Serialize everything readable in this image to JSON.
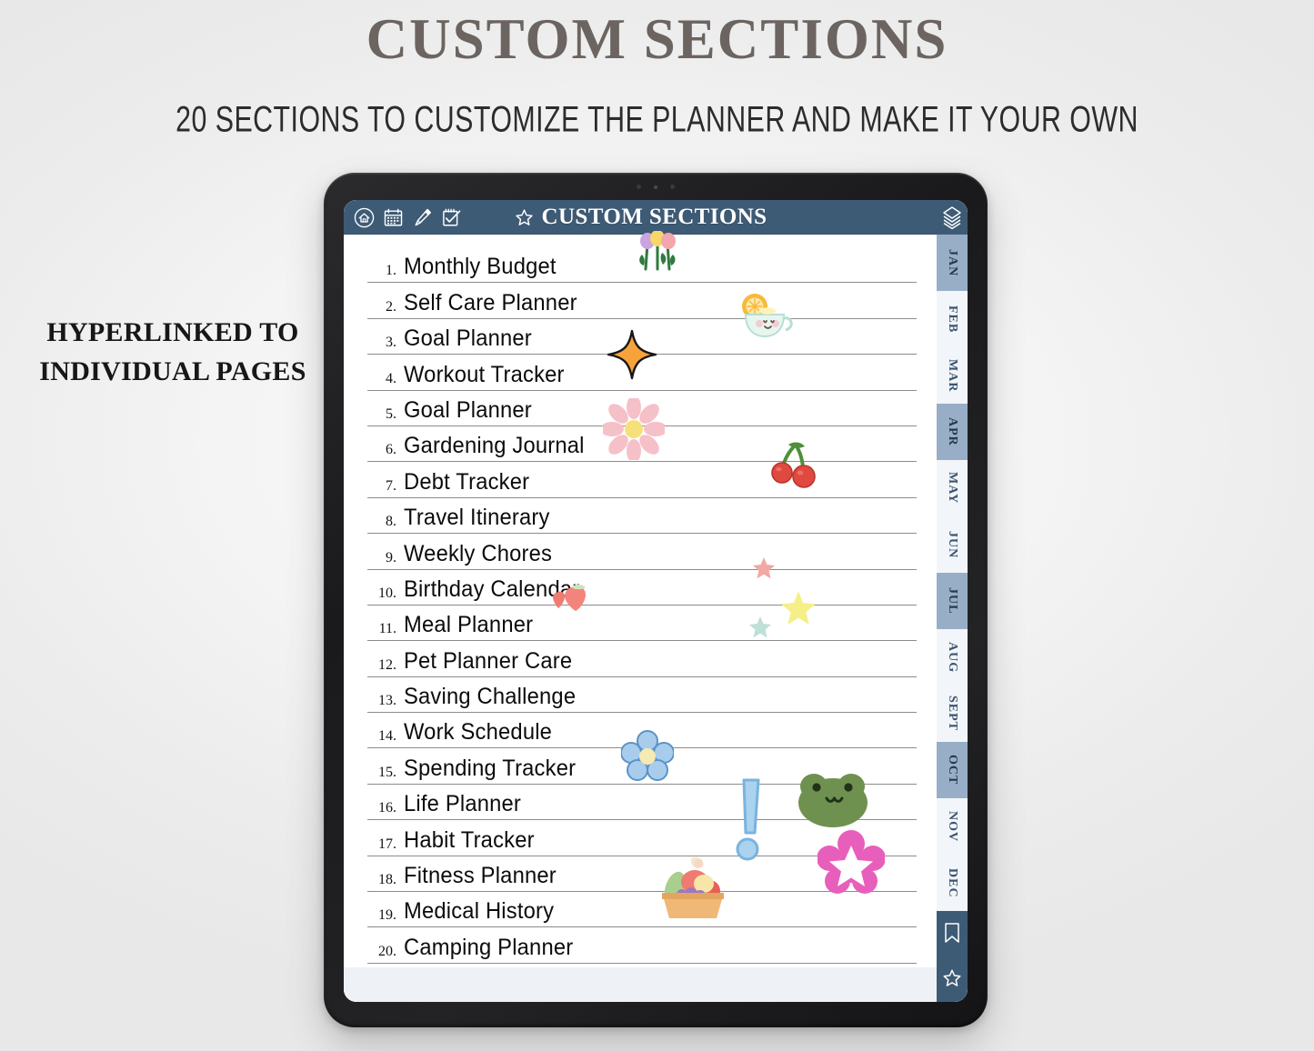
{
  "promo": {
    "title": "CUSTOM SECTIONS",
    "subtitle": "20 SECTIONS TO CUSTOMIZE THE PLANNER AND MAKE IT YOUR OWN",
    "side_note": "HYPERLINKED TO INDIVIDUAL PAGES"
  },
  "planner": {
    "header": {
      "title": "CUSTOM SECTIONS",
      "star_icon": "star-outline-icon",
      "bar_color": "#3e5b76",
      "icons": [
        "home-icon",
        "calendar-icon",
        "pen-icon",
        "checklist-icon"
      ]
    },
    "sections": [
      {
        "num": "1.",
        "label": "Monthly Budget"
      },
      {
        "num": "2.",
        "label": "Self Care Planner"
      },
      {
        "num": "3.",
        "label": "Goal Planner"
      },
      {
        "num": "4.",
        "label": "Workout Tracker"
      },
      {
        "num": "5.",
        "label": "Goal Planner"
      },
      {
        "num": "6.",
        "label": "Gardening Journal"
      },
      {
        "num": "7.",
        "label": "Debt Tracker"
      },
      {
        "num": "8.",
        "label": "Travel Itinerary"
      },
      {
        "num": "9.",
        "label": "Weekly Chores"
      },
      {
        "num": "10.",
        "label": "Birthday Calendar"
      },
      {
        "num": "11.",
        "label": "Meal Planner"
      },
      {
        "num": "12.",
        "label": "Pet Planner Care"
      },
      {
        "num": "13.",
        "label": "Saving Challenge"
      },
      {
        "num": "14.",
        "label": "Work Schedule"
      },
      {
        "num": "15.",
        "label": "Spending Tracker"
      },
      {
        "num": "16.",
        "label": "Life Planner"
      },
      {
        "num": "17.",
        "label": "Habit Tracker"
      },
      {
        "num": "18.",
        "label": "Fitness Planner"
      },
      {
        "num": "19.",
        "label": "Medical History"
      },
      {
        "num": "20.",
        "label": "Camping Planner"
      }
    ],
    "month_tabs": [
      {
        "label": "JAN",
        "style": "dark"
      },
      {
        "label": "FEB",
        "style": "light"
      },
      {
        "label": "MAR",
        "style": "light"
      },
      {
        "label": "APR",
        "style": "dark"
      },
      {
        "label": "MAY",
        "style": "light"
      },
      {
        "label": "JUN",
        "style": "light"
      },
      {
        "label": "JUL",
        "style": "dark"
      },
      {
        "label": "AUG",
        "style": "light"
      },
      {
        "label": "SEPT",
        "style": "light"
      },
      {
        "label": "OCT",
        "style": "dark"
      },
      {
        "label": "NOV",
        "style": "light"
      },
      {
        "label": "DEC",
        "style": "light"
      }
    ],
    "rail_icons": {
      "top": "layers-stack-icon",
      "bookmark": "bookmark-icon",
      "star": "star-outline-icon"
    },
    "stickers": [
      "tulips-sticker",
      "orange-sparkle-star-sticker",
      "lemon-teacup-sticker",
      "pink-daisy-sticker",
      "cherries-sticker",
      "strawberries-sticker",
      "pink-star-sticker",
      "yellow-star-sticker",
      "teal-star-sticker",
      "blue-flower-sticker",
      "blue-exclamation-sticker",
      "green-frog-sticker",
      "pink-flower-sticker",
      "fruit-basket-sticker"
    ]
  },
  "colors": {
    "header_blue": "#3e5b76",
    "tab_dark": "#98aec6",
    "tab_light": "#f2f6fa",
    "rule": "#8c8c8c",
    "promo_title": "#6b6460"
  }
}
